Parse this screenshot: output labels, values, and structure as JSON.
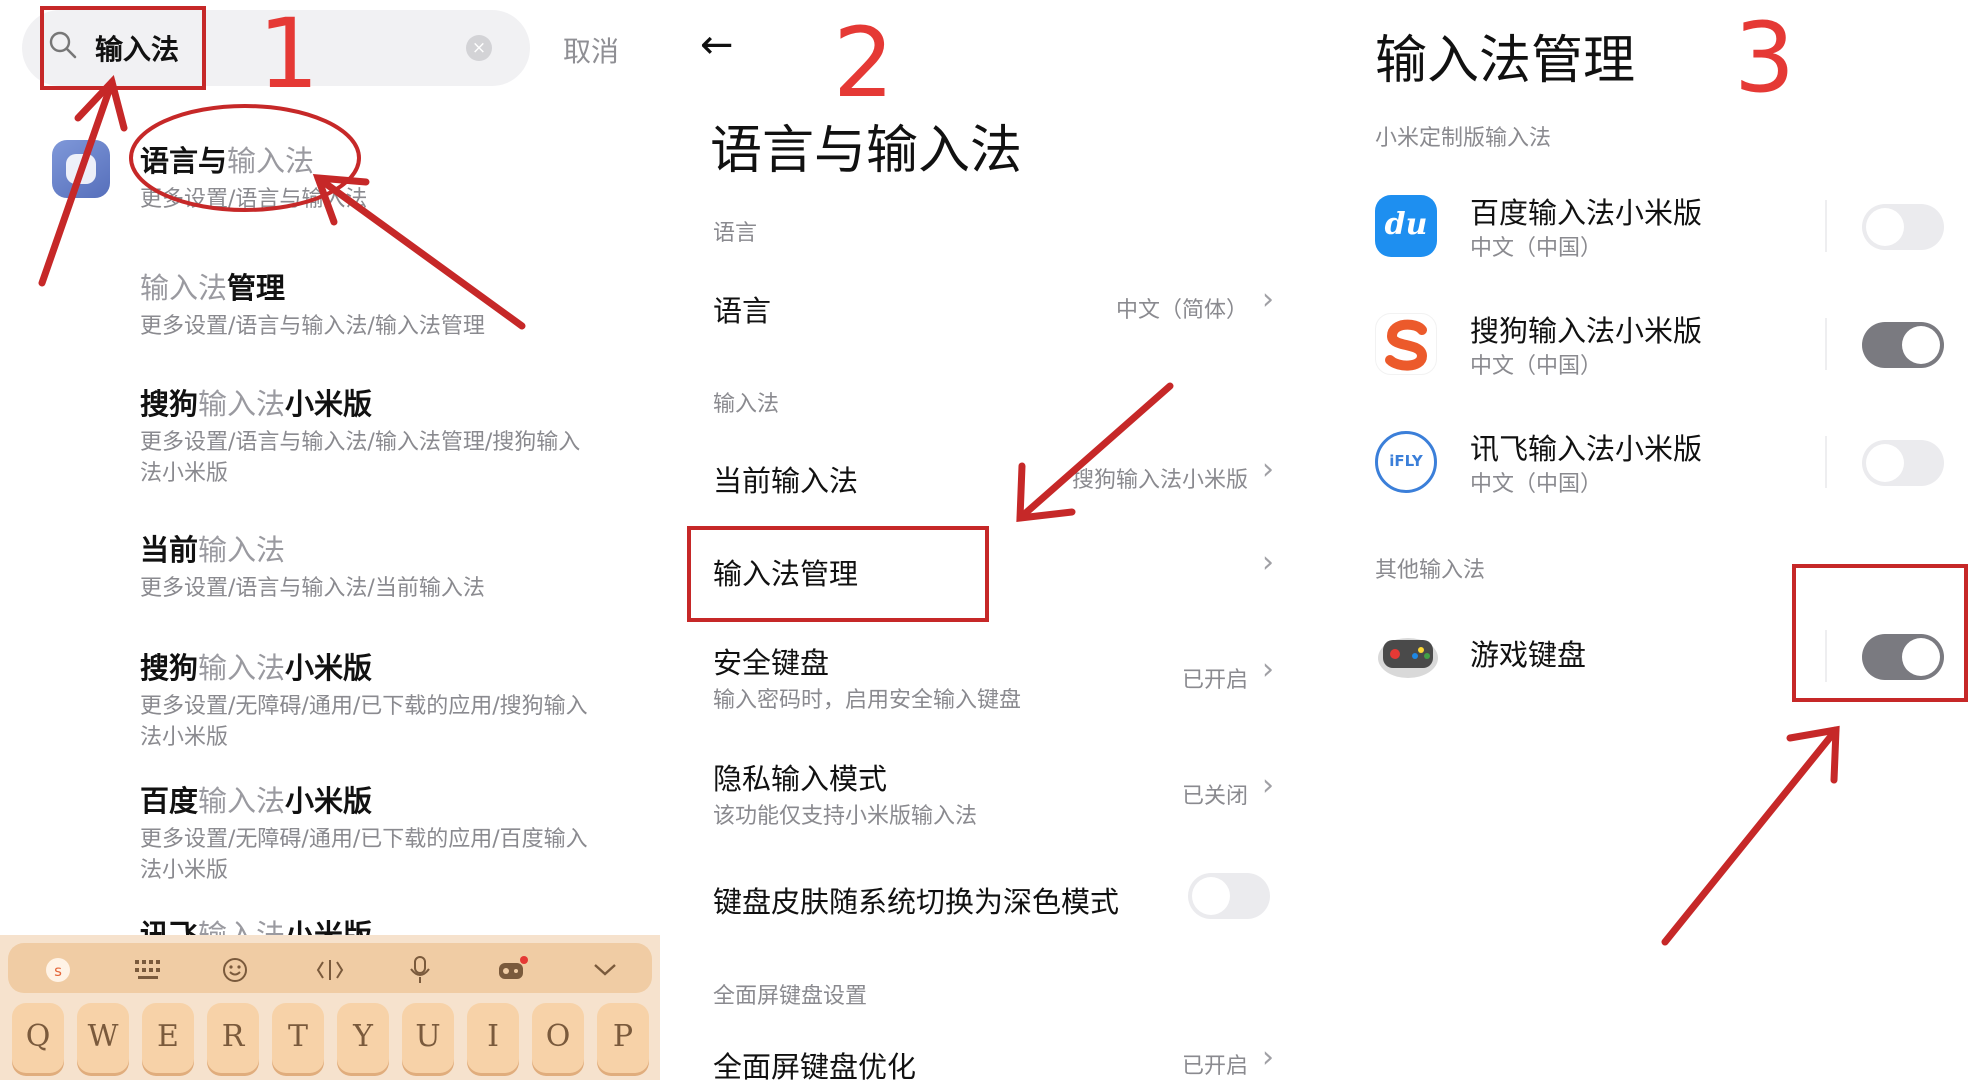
{
  "panel1": {
    "search": {
      "query": "输入法",
      "clear_glyph": "×",
      "cancel_label": "取消"
    },
    "results": [
      {
        "title_hl": "",
        "title_main": "语言与",
        "title_tail": "输入法",
        "subtitle": "更多设置/语言与输入法"
      },
      {
        "title_hl": "输入法",
        "title_main": "管理",
        "title_tail": "",
        "subtitle": "更多设置/语言与输入法/输入法管理"
      },
      {
        "title_pre": "搜狗",
        "title_hl": "输入法",
        "title_main": "小米版",
        "subtitle": "更多设置/语言与输入法/输入法管理/搜狗输入法小米版"
      },
      {
        "title_pre": "当前",
        "title_hl": "输入法",
        "title_main": "",
        "subtitle": "更多设置/语言与输入法/当前输入法"
      },
      {
        "title_pre": "搜狗",
        "title_hl": "输入法",
        "title_main": "小米版",
        "subtitle": "更多设置/无障碍/通用/已下载的应用/搜狗输入法小米版"
      },
      {
        "title_pre": "百度",
        "title_hl": "输入法",
        "title_main": "小米版",
        "subtitle": "更多设置/无障碍/通用/已下载的应用/百度输入法小米版"
      },
      {
        "title_pre": "讯飞",
        "title_hl": "输入法",
        "title_main": "小米版",
        "subtitle": ""
      }
    ],
    "keyboard": {
      "toolbar_icons": [
        "sogou-logo-icon",
        "grid-icon",
        "smiley-icon",
        "cursor-icon",
        "mic-icon",
        "game-controller-icon",
        "chevron-down-icon"
      ],
      "keys": [
        "Q",
        "W",
        "E",
        "R",
        "T",
        "Y",
        "U",
        "I",
        "O",
        "P"
      ]
    },
    "step_number": "1"
  },
  "panel2": {
    "back_glyph": "←",
    "title": "语言与输入法",
    "step_number": "2",
    "sections": {
      "language": "语言",
      "ime": "输入法",
      "fullscreen": "全面屏键盘设置"
    },
    "rows": {
      "language": {
        "title": "语言",
        "value": "中文（简体）"
      },
      "current_ime": {
        "title": "当前输入法",
        "value": "搜狗输入法小米版"
      },
      "ime_manage": {
        "title": "输入法管理"
      },
      "secure_keyboard": {
        "title": "安全键盘",
        "subtitle": "输入密码时，启用安全输入键盘",
        "value": "已开启"
      },
      "privacy_mode": {
        "title": "隐私输入模式",
        "subtitle": "该功能仅支持小米版输入法",
        "value": "已关闭"
      },
      "dark_skin": {
        "title": "键盘皮肤随系统切换为深色模式",
        "toggle_on": false
      },
      "fullscreen_opt": {
        "title": "全面屏键盘优化",
        "value": "已开启"
      }
    },
    "chevron": "›"
  },
  "panel3": {
    "title": "输入法管理",
    "step_number": "3",
    "section_custom": "小米定制版输入法",
    "section_other": "其他输入法",
    "imes": [
      {
        "name": "百度输入法小米版",
        "locale": "中文（中国）",
        "icon": "baidu-ime-icon",
        "icon_text": "du",
        "enabled": false
      },
      {
        "name": "搜狗输入法小米版",
        "locale": "中文（中国）",
        "icon": "sogou-ime-icon",
        "icon_text": "S",
        "enabled": true
      },
      {
        "name": "讯飞输入法小米版",
        "locale": "中文（中国）",
        "icon": "iflytek-ime-icon",
        "icon_text": "iFLY",
        "enabled": false
      }
    ],
    "other_imes": [
      {
        "name": "游戏键盘",
        "icon": "game-keyboard-icon",
        "enabled": true
      }
    ]
  },
  "colors": {
    "annotation_red": "#c62828",
    "step_number_red": "#e53935",
    "toggle_on": "#7a7a80",
    "toggle_off": "#ebebee"
  }
}
